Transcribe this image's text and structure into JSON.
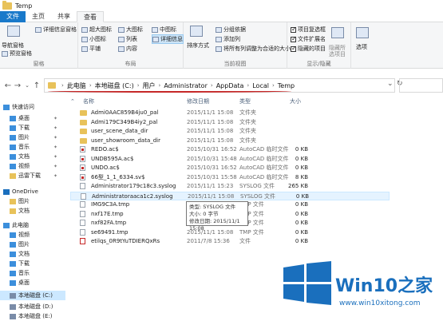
{
  "window": {
    "title": "Temp"
  },
  "ribbon_tabs": [
    "文件",
    "主页",
    "共享",
    "查看"
  ],
  "ribbon": {
    "pane_group": {
      "nav_pane": "导航窗格",
      "preview_pane": "预览窗格",
      "details_pane": "详细信息窗格",
      "label": "窗格"
    },
    "layout_group": {
      "items": [
        "超大图标",
        "大图标",
        "中图标",
        "小图标",
        "列表",
        "详细信息",
        "平铺",
        "内容"
      ],
      "selected": "详细信息",
      "label": "布局"
    },
    "view_group": {
      "sort": "排序方式",
      "group_by": "分组依据",
      "add_col": "添加列",
      "fit_cols": "将所有列调整为合适的大小",
      "label": "当前视图"
    },
    "show_hide": {
      "checkboxes": [
        {
          "label": "项目复选框",
          "checked": true
        },
        {
          "label": "文件扩展名",
          "checked": true
        },
        {
          "label": "隐藏的项目",
          "checked": true
        }
      ],
      "hide_selected": "隐藏所选项目",
      "label": "显示/隐藏"
    },
    "options": "选项"
  },
  "address": {
    "crumbs": [
      "此电脑",
      "本地磁盘 (C:)",
      "用户",
      "Administrator",
      "AppData",
      "Local",
      "Temp"
    ]
  },
  "nav": {
    "items": [
      {
        "label": "快速访问",
        "icon": "star-icon",
        "color": "#3c8fdc"
      },
      {
        "label": "桌面",
        "icon": "desktop-icon",
        "color": "#3c8fdc",
        "pinned": true
      },
      {
        "label": "下载",
        "icon": "download-icon",
        "color": "#3c8fdc",
        "pinned": true
      },
      {
        "label": "图片",
        "icon": "picture-icon",
        "color": "#3c8fdc",
        "pinned": true
      },
      {
        "label": "音乐",
        "icon": "music-icon",
        "color": "#3c8fdc",
        "pinned": true
      },
      {
        "label": "文档",
        "icon": "document-icon",
        "color": "#3c8fdc",
        "pinned": true
      },
      {
        "label": "视频",
        "icon": "video-icon",
        "color": "#3c8fdc",
        "pinned": true
      },
      {
        "label": "迅雷下载",
        "icon": "folder-icon",
        "color": "#e8c25a",
        "pinned": true
      },
      {
        "label": "OneDrive",
        "icon": "cloud-icon",
        "color": "#1a6fbd"
      },
      {
        "label": "图片",
        "icon": "folder-icon",
        "color": "#e8c25a"
      },
      {
        "label": "文档",
        "icon": "folder-icon",
        "color": "#e8c25a"
      },
      {
        "label": "此电脑",
        "icon": "computer-icon",
        "color": "#3c8fdc"
      },
      {
        "label": "视频",
        "icon": "video-icon",
        "color": "#3c8fdc"
      },
      {
        "label": "图片",
        "icon": "picture-icon",
        "color": "#3c8fdc"
      },
      {
        "label": "文档",
        "icon": "document-icon",
        "color": "#3c8fdc"
      },
      {
        "label": "下载",
        "icon": "download-icon",
        "color": "#3c8fdc"
      },
      {
        "label": "音乐",
        "icon": "music-icon",
        "color": "#3c8fdc"
      },
      {
        "label": "桌面",
        "icon": "desktop-icon",
        "color": "#3c8fdc"
      },
      {
        "label": "本地磁盘 (C:)",
        "icon": "drive-icon",
        "color": "#7a8ca8",
        "selected": true
      },
      {
        "label": "本地磁盘 (D:)",
        "icon": "drive-icon",
        "color": "#7a8ca8"
      },
      {
        "label": "本地磁盘 (E:)",
        "icon": "drive-icon",
        "color": "#7a8ca8"
      }
    ]
  },
  "columns": [
    "名称",
    "修改日期",
    "类型",
    "大小"
  ],
  "files": [
    {
      "name": "Admi0AAC859B4ju0_pal",
      "date": "2015/11/1 15:08",
      "type": "文件夹",
      "size": "",
      "kind": "folder"
    },
    {
      "name": "Admi179C349B4iy2_pal",
      "date": "2015/11/1 15:08",
      "type": "文件夹",
      "size": "",
      "kind": "folder"
    },
    {
      "name": "user_scene_data_dir",
      "date": "2015/11/1 15:08",
      "type": "文件夹",
      "size": "",
      "kind": "folder"
    },
    {
      "name": "user_showroom_data_dir",
      "date": "2015/11/1 15:08",
      "type": "文件夹",
      "size": "",
      "kind": "folder"
    },
    {
      "name": "REDO.ac$",
      "date": "2015/10/31 16:52",
      "type": "AutoCAD 临时文件",
      "size": "0 KB",
      "kind": "cad"
    },
    {
      "name": "UNDB595A.ac$",
      "date": "2015/10/31 15:48",
      "type": "AutoCAD 临时文件",
      "size": "0 KB",
      "kind": "cad"
    },
    {
      "name": "UNDO.ac$",
      "date": "2015/10/31 16:52",
      "type": "AutoCAD 临时文件",
      "size": "0 KB",
      "kind": "cad"
    },
    {
      "name": "66型_1_1_6334.sv$",
      "date": "2015/10/31 15:58",
      "type": "AutoCAD 临时文件",
      "size": "8 KB",
      "kind": "cad"
    },
    {
      "name": "Administrator179c18c3.syslog",
      "date": "2015/11/1 15:23",
      "type": "SYSLOG 文件",
      "size": "265 KB",
      "kind": "file"
    },
    {
      "name": "Administratoraaca1c2.syslog",
      "date": "2015/11/1 15:08",
      "type": "SYSLOG 文件",
      "size": "0 KB",
      "kind": "file",
      "highlight": true
    },
    {
      "name": "IMG9C3A.tmp",
      "date": "2015/11/1 15:08",
      "type": "TMP 文件",
      "size": "0 KB",
      "kind": "file"
    },
    {
      "name": "nxf17E.tmp",
      "date": "2015/11/1 15:08",
      "type": "TMP 文件",
      "size": "0 KB",
      "kind": "file"
    },
    {
      "name": "nxf82FA.tmp",
      "date": "2015/11/1 15:08",
      "type": "TMP 文件",
      "size": "0 KB",
      "kind": "file"
    },
    {
      "name": "se69491.tmp",
      "date": "2015/11/1 15:08",
      "type": "TMP 文件",
      "size": "0 KB",
      "kind": "file"
    },
    {
      "name": "etilqs_0R9tYuTDIERQxRs",
      "date": "2011/7/8 15:36",
      "type": "文件",
      "size": "0 KB",
      "kind": "svc"
    }
  ],
  "tooltip": {
    "type": "类型: SYSLOG 文件",
    "size": "大小: 0 字节",
    "modified": "修改日期: 2015/11/1 15:08"
  },
  "watermark": {
    "brand": "Win10",
    "brand_suffix": "之家",
    "url": "www.win10xitong.com",
    "color": "#1a6fbd"
  }
}
